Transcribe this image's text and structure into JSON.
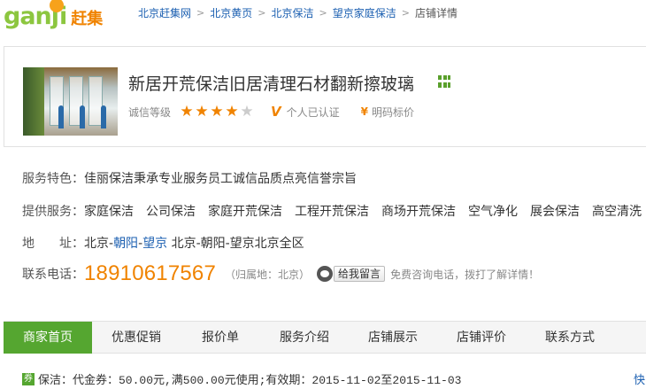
{
  "logo": {
    "text_latin": "ganji",
    "text_cn": "赶集"
  },
  "breadcrumb": {
    "items": [
      "北京赶集网",
      "北京黄页",
      "北京保洁",
      "望京家庭保洁"
    ],
    "current": "店铺详情",
    "separator": ">"
  },
  "store": {
    "title": "新居开荒保洁旧居清理石材翻新擦玻璃",
    "rating_label": "诚信等级",
    "rating_stars": 4,
    "rating_max": 5,
    "verified_label": "个人已认证",
    "price_label": "明码标价"
  },
  "info": {
    "feature_label": "服务特色：",
    "feature_value": "佳丽保洁秉承专业服务员工诚信品质点亮信誉宗旨",
    "services_label": "提供服务：",
    "services": [
      "家庭保洁",
      "公司保洁",
      "家庭开荒保洁",
      "工程开荒保洁",
      "商场开荒保洁",
      "空气净化",
      "展会保洁",
      "高空清洗"
    ],
    "address_label": "地　　址：",
    "address_city": "北京-",
    "address_district": "朝阳",
    "address_dash": "-",
    "address_area": "望京",
    "address_rest": " 北京-朝阳-望京北京全区",
    "phone_label": "联系电话：",
    "phone": "18910617567",
    "phone_note": "（归属地：北京）",
    "message_button": "给我留言",
    "free_call": "免费咨询电话，拨打了解详情！"
  },
  "tabs": [
    "商家首页",
    "优惠促销",
    "报价单",
    "服务介绍",
    "店铺展示",
    "店铺评价",
    "联系方式"
  ],
  "active_tab": 0,
  "promo": {
    "tag": "券",
    "text": "保洁：代金券：50.00元,满500.00元使用;有效期：2015-11-02至2015-11-03"
  },
  "fast_link": "快",
  "colors": {
    "brand_green": "#55a630",
    "accent_orange": "#f08300",
    "link_blue": "#1b5fb1"
  }
}
